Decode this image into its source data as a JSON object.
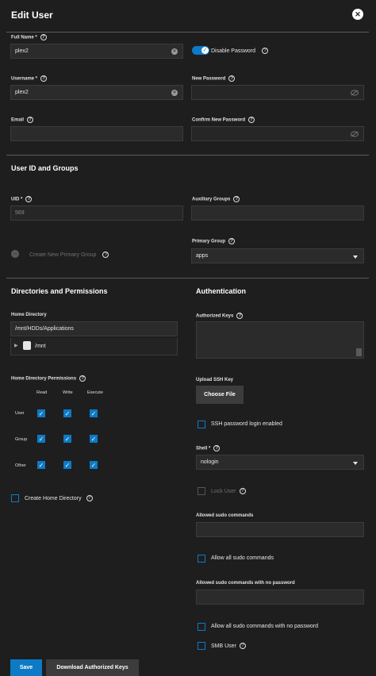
{
  "dialog": {
    "title": "Edit User",
    "close_icon": "close-icon"
  },
  "fields": {
    "full_name": {
      "label": "Full Name *",
      "value": "plex2"
    },
    "disable_password": {
      "label": "Disable Password",
      "on": true
    },
    "username": {
      "label": "Username *",
      "value": "plex2"
    },
    "new_password": {
      "label": "New Password",
      "value": ""
    },
    "email": {
      "label": "Email",
      "value": ""
    },
    "confirm_password": {
      "label": "Confirm New Password",
      "value": ""
    }
  },
  "user_groups": {
    "heading": "User ID and Groups",
    "uid_label": "UID *",
    "uid_value": "569",
    "aux_groups_label": "Auxiliary Groups",
    "create_primary_label": "Create New Primary Group",
    "primary_group_label": "Primary Group",
    "primary_group_value": "apps"
  },
  "directories": {
    "heading": "Directories and Permissions",
    "home_dir_label": "Home Directory",
    "home_dir_value": "/mnt/HDDs/Applications",
    "tree_item": "/mnt",
    "perms_label": "Home Directory Permissions",
    "columns": [
      "Read",
      "Write",
      "Execute"
    ],
    "rows": [
      {
        "name": "User",
        "checks": [
          true,
          true,
          true
        ]
      },
      {
        "name": "Group",
        "checks": [
          true,
          true,
          true
        ]
      },
      {
        "name": "Other",
        "checks": [
          true,
          true,
          true
        ]
      }
    ],
    "create_home_label": "Create Home Directory"
  },
  "auth": {
    "heading": "Authentication",
    "authorized_keys_label": "Authorized Keys",
    "upload_ssh_label": "Upload SSH Key",
    "choose_file": "Choose File",
    "ssh_password_login": "SSH password login enabled",
    "shell_label": "Shell *",
    "shell_value": "nologin",
    "lock_user": "Lock User",
    "sudo_label": "Allowed sudo commands",
    "allow_all_sudo": "Allow all sudo commands",
    "sudo_nopass_label": "Allowed sudo commands with no password",
    "allow_all_sudo_nopass": "Allow all sudo commands with no password",
    "smb_user": "SMB User"
  },
  "footer": {
    "save": "Save",
    "download_keys": "Download Authorized Keys"
  },
  "colors": {
    "accent": "#0d7ac6",
    "background": "#1e1e1e",
    "input": "#2b2b2b"
  }
}
